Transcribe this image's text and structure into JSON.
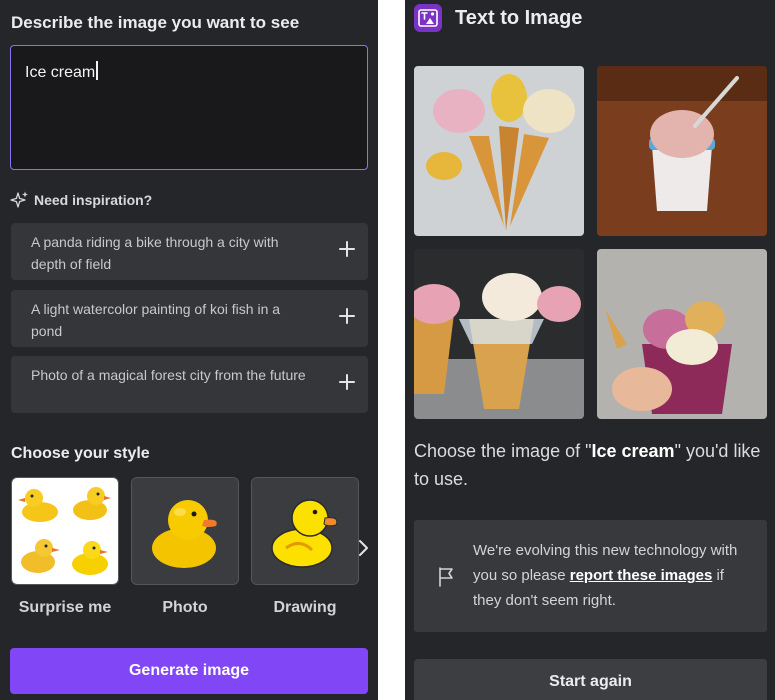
{
  "left_panel": {
    "title": "Describe the image you want to see",
    "prompt": {
      "value": "Ice cream"
    },
    "inspiration": {
      "icon": "sparkle-icon",
      "label": "Need inspiration?",
      "suggestions": [
        {
          "text": "A panda riding a bike through a city with depth of field",
          "icon": "plus-icon"
        },
        {
          "text": "A light watercolor painting of koi fish in a pond",
          "icon": "plus-icon"
        },
        {
          "text": "Photo of a magical forest city from the future",
          "icon": "plus-icon"
        }
      ]
    },
    "style": {
      "title": "Choose your style",
      "options": [
        {
          "label": "Surprise me",
          "image": "four-rubber-ducks"
        },
        {
          "label": "Photo",
          "image": "photo-rubber-duck"
        },
        {
          "label": "Drawing",
          "image": "drawn-rubber-duck"
        }
      ],
      "next_icon": "chevron-right-icon"
    },
    "generate_label": "Generate image",
    "colors": {
      "background": "#252629",
      "accent": "#8146f5",
      "input_border": "#8b72f0"
    }
  },
  "right_panel": {
    "app_icon": "text-to-image-app-icon",
    "title": "Text to Image",
    "results": [
      {
        "image": "ice-cream-cones-bouquet"
      },
      {
        "image": "ice-cream-cup-with-spoon"
      },
      {
        "image": "ice-cream-cones-in-cup"
      },
      {
        "image": "hand-holding-ice-cream-cup"
      }
    ],
    "choose": {
      "before": "Choose the image of \"",
      "query": "Ice cream",
      "after": "\" you'd like to use."
    },
    "notice": {
      "icon": "flag-icon",
      "before": "We're evolving this new technology with you so please ",
      "link": "report these images",
      "after": " if they don't seem right."
    },
    "start_again_label": "Start again"
  }
}
